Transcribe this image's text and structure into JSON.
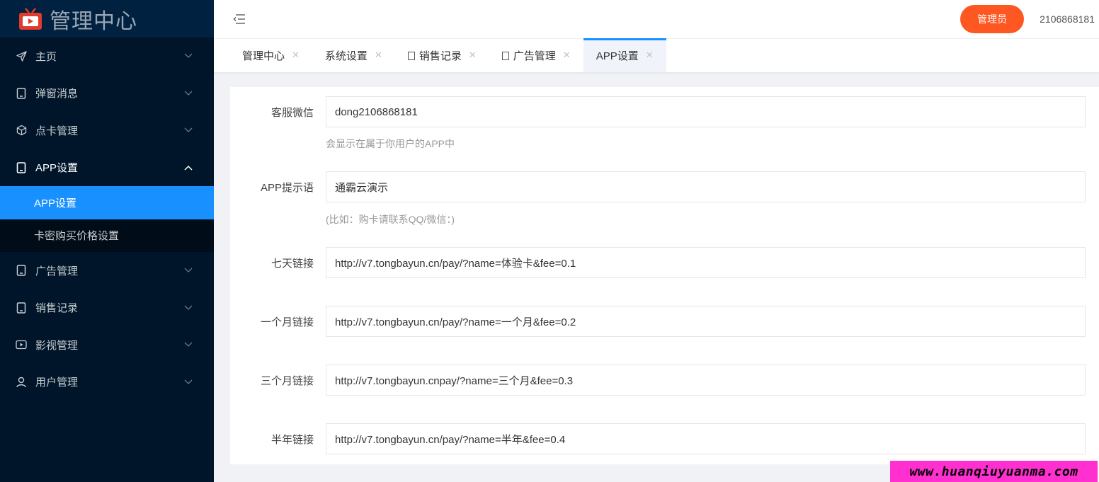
{
  "sidebar": {
    "logo": {
      "icon": "tv-icon",
      "title": "管理中心",
      "icon_color": "#e03b2c"
    },
    "items": [
      {
        "label": "主页",
        "icon": "send-icon",
        "expanded": false
      },
      {
        "label": "弹窗消息",
        "icon": "tablet-icon",
        "expanded": false
      },
      {
        "label": "点卡管理",
        "icon": "cube-icon",
        "expanded": false
      },
      {
        "label": "APP设置",
        "icon": "tablet-icon",
        "expanded": true,
        "children": [
          {
            "label": "APP设置",
            "active": true
          },
          {
            "label": "卡密购买价格设置",
            "active": false
          }
        ]
      },
      {
        "label": "广告管理",
        "icon": "tablet-icon",
        "expanded": false
      },
      {
        "label": "销售记录",
        "icon": "tablet-icon",
        "expanded": false
      },
      {
        "label": "影视管理",
        "icon": "play-icon",
        "expanded": false
      },
      {
        "label": "用户管理",
        "icon": "user-icon",
        "expanded": false
      }
    ]
  },
  "header": {
    "role_label": "管理员",
    "username": "2106868181"
  },
  "tabs": [
    {
      "label": "管理中心",
      "has_icon": false,
      "active": false
    },
    {
      "label": "系统设置",
      "has_icon": false,
      "active": false
    },
    {
      "label": "销售记录",
      "has_icon": true,
      "active": false
    },
    {
      "label": "广告管理",
      "has_icon": true,
      "active": false
    },
    {
      "label": "APP设置",
      "has_icon": false,
      "active": true
    }
  ],
  "tab_close": "✕",
  "form": {
    "fields": [
      {
        "label": "客服微信",
        "value": "dong2106868181",
        "hint": "会显示在属于你用户的APP中"
      },
      {
        "label": "APP提示语",
        "value": "通霸云演示",
        "hint": "(比如：购卡请联系QQ/微信：)"
      },
      {
        "label": "七天链接",
        "value": "http://v7.tongbayun.cn/pay/?name=体验卡&fee=0.1",
        "hint": ""
      },
      {
        "label": "一个月链接",
        "value": "http://v7.tongbayun.cn/pay/?name=一个月&fee=0.2",
        "hint": ""
      },
      {
        "label": "三个月链接",
        "value": "http://v7.tongbayun.cnpay/?name=三个月&fee=0.3",
        "hint": ""
      },
      {
        "label": "半年链接",
        "value": "http://v7.tongbayun.cn/pay/?name=半年&fee=0.4",
        "hint": ""
      }
    ]
  },
  "watermark": "www.huanqiuyuanma.com",
  "colors": {
    "sidebar_bg": "#001529",
    "active_menu": "#1890ff",
    "role_button": "#ff5722",
    "watermark_bg": "#ff2fd0"
  }
}
